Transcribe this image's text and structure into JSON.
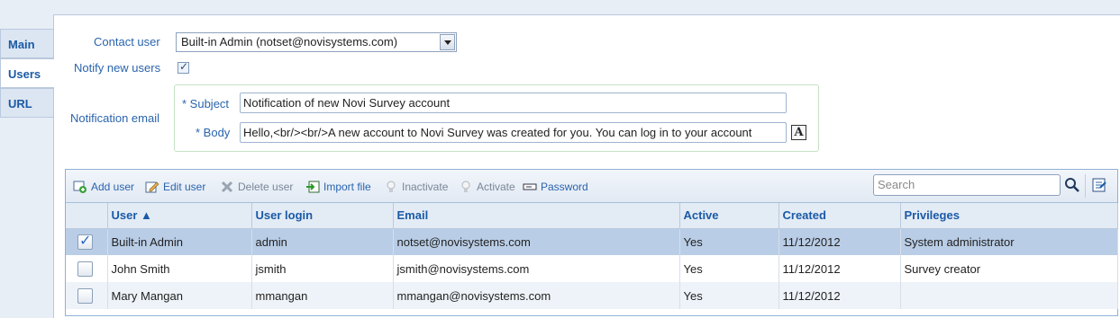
{
  "tabs": [
    {
      "label": "Main"
    },
    {
      "label": "Users"
    },
    {
      "label": "URL"
    }
  ],
  "form": {
    "contact_user_label": "Contact user",
    "contact_user_value": "Built-in Admin (notset@novisystems.com)",
    "notify_label": "Notify new users",
    "notification_email_label": "Notification email",
    "subject_label": "* Subject",
    "subject_value": "Notification of new Novi Survey account",
    "body_label": "* Body",
    "body_value": "Hello,<br/><br/>A new account to Novi Survey was created for you. You can log in to your account",
    "font_icon_glyph": "A"
  },
  "toolbar": {
    "add_user": "Add user",
    "edit_user": "Edit user",
    "delete_user": "Delete user",
    "import_file": "Import file",
    "inactivate": "Inactivate",
    "activate": "Activate",
    "password": "Password",
    "search_placeholder": "Search"
  },
  "table": {
    "columns": [
      "User ▲",
      "User login",
      "Email",
      "Active",
      "Created",
      "Privileges"
    ],
    "rows": [
      {
        "checked": true,
        "user": "Built-in Admin",
        "login": "admin",
        "email": "notset@novisystems.com",
        "active": "Yes",
        "created": "11/12/2012",
        "privileges": "System administrator"
      },
      {
        "checked": false,
        "user": "John Smith",
        "login": "jsmith",
        "email": "jsmith@novisystems.com",
        "active": "Yes",
        "created": "11/12/2012",
        "privileges": "Survey creator"
      },
      {
        "checked": false,
        "user": "Mary Mangan",
        "login": "mmangan",
        "email": "mmangan@novisystems.com",
        "active": "Yes",
        "created": "11/12/2012",
        "privileges": ""
      }
    ]
  },
  "colors": {
    "accent": "#1a5aa6",
    "selected_row": "#b9cde6"
  }
}
